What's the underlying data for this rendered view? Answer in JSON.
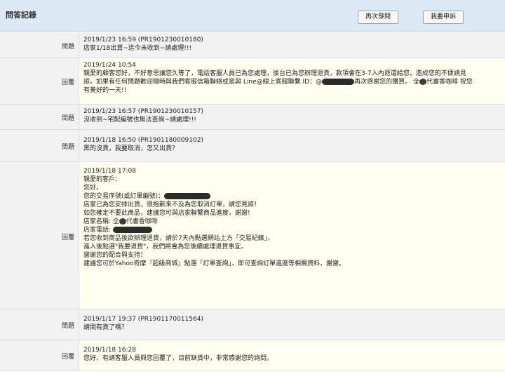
{
  "header": {
    "title": "問答記錄",
    "ask_again_label": "再次發問",
    "complain_label": "我要申訴"
  },
  "labels": {
    "question": "問題",
    "answer": "回覆"
  },
  "entries": [
    {
      "type": "question",
      "lines": [
        "2019/1/23 16:59 (PR1901230010180)",
        "店家1/18出貨~迄今未收到~請處理!!!"
      ]
    },
    {
      "type": "answer",
      "lines": [
        "2019/1/24 10:54",
        "親愛的顧客您好，不好意思讓您久等了，電話客服人員已為您處理，後台已為您辦理退貨，款項會在3-7入內退還給您，造成您的不便請見",
        "諒。如果有任何問題歡迎隨時與我們客服信箱聯絡或是與 Line@線上客服聯繫 ID：@",
        "再次感謝您的購買。 全",
        "代書香咖啡 祝您",
        "有美好的一天!!"
      ]
    },
    {
      "type": "question",
      "lines": [
        "2019/1/23 16:57 (PR1901230010157)",
        "沒收到~宅配編號也無法查詢~請處理!!!"
      ]
    },
    {
      "type": "question",
      "lines": [
        "2019/1/18 16:50 (PR1901180009102)",
        "黑的沒貨，我要取消，怎又出貨？"
      ]
    },
    {
      "type": "answer",
      "lines": [
        "2019/1/18 17:08",
        "親愛的客戶：",
        "您好，",
        "",
        "您的交易序號(或訂單編號)：",
        "店家已為您安排出貨，很抱歉來不及為您取消訂單，請您見諒！",
        "",
        "如您確定不要此商品，建議您可與店家聯繫商品進度，謝謝!",
        "店家名稱: 全",
        "代書香咖啡",
        "店家電話:",
        "",
        "若您收到商品後欲辦理退貨，請於7天內點選網站上方「交易紀錄」，",
        "進入後點選\"我要退貨\"，我們將會為您後續處理退貨事宜。",
        "謝謝您的配合與支持！",
        "",
        "建議您可於Yahoo奇摩『超級商城』點選「訂單查詢」，即可查詢訂單進度等相關資料，謝謝。"
      ]
    },
    {
      "type": "question",
      "lines": [
        "2019/1/17 19:37 (PR1901170011564)",
        "請問有貨了嗎？"
      ]
    },
    {
      "type": "answer",
      "lines": [
        "2019/1/18 16:28",
        "您好，有請客服人員與您回覆了，目前缺貨中，非常感謝您的詢問。"
      ]
    }
  ]
}
